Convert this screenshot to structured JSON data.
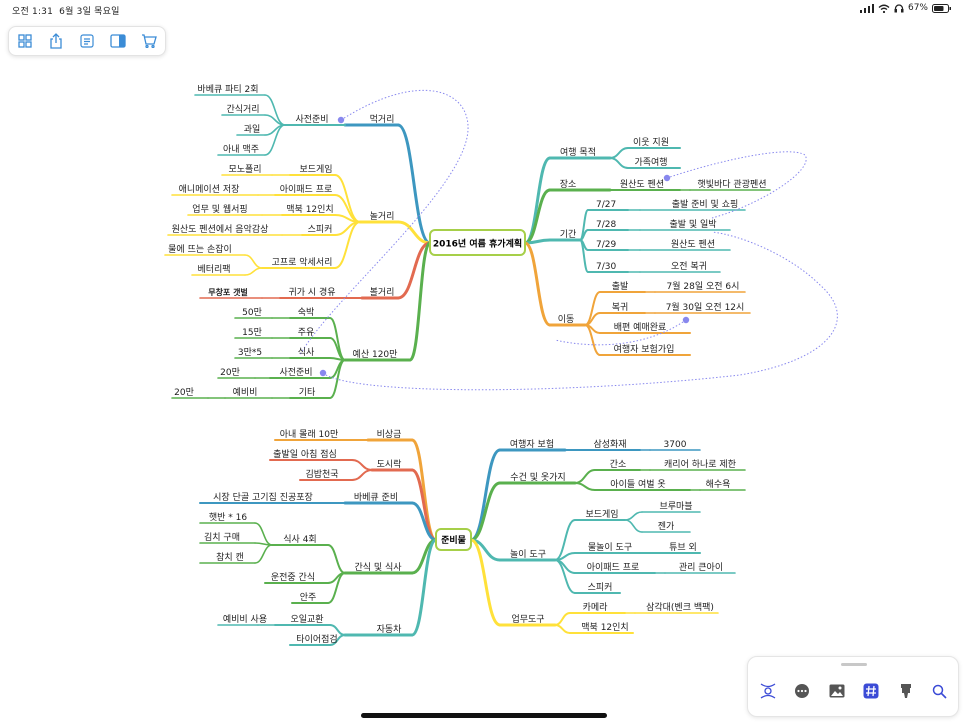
{
  "status_bar": {
    "time": "오전 1:31",
    "date": "6월 3일 목요일",
    "battery": "67%"
  },
  "toolbar": {
    "buttons": [
      "grid-view",
      "share",
      "outline",
      "panel",
      "cart"
    ]
  },
  "colors": {
    "teal": "#4fb8b0",
    "blue": "#3d97c0",
    "yellow": "#ffe13a",
    "green": "#5ab04e",
    "red": "#e26a50",
    "orange": "#f0a43a",
    "relation": "#8888ee",
    "root_border": "#a6cf49"
  },
  "map1": {
    "root": "2016년 여름 휴가계획",
    "food": "먹거리",
    "food_prep": "사전준비",
    "food_bbq": "바베큐 파티 2회",
    "food_snack": "간식거리",
    "food_fruit": "과일",
    "food_beer": "아내 맥주",
    "play": "놀거리",
    "play_board": "보드게임",
    "play_monopoly": "모노폴리",
    "play_ipad": "아이패드 프로",
    "play_anim": "애니메이션 저장",
    "play_mac": "맥북 12인치",
    "play_web": "업무 및 웹서핑",
    "play_speaker": "스피커",
    "play_music": "원산도 펜션에서 음악감상",
    "play_gopro": "고프로 악세서리",
    "play_mount": "물에 뜨는 손잡이",
    "play_battery": "베터리팩",
    "see": "볼거리",
    "see_return": "귀가 시 경유",
    "see_mud": "무창포 갯벌",
    "budget": "예산 120만",
    "budget_stay": "숙박",
    "budget_stay_v": "50만",
    "budget_fuel": "주유",
    "budget_fuel_v": "15만",
    "budget_meal": "식사",
    "budget_meal_v": "3만*5",
    "budget_prep": "사전준비",
    "budget_prep_v": "20만",
    "budget_etc": "기타",
    "budget_spare": "예비비",
    "budget_spare_v": "20만",
    "purpose": "여행 목적",
    "purpose_help": "이웃 지원",
    "purpose_family": "가족여행",
    "place": "장소",
    "place_pension": "원산도 펜션",
    "place_tour": "햇빛바다 관광펜션",
    "period": "기간",
    "d1": "7/27",
    "d1_v": "출발 준비 및 쇼핑",
    "d2": "7/28",
    "d2_v": "출발 및 일박",
    "d3": "7/29",
    "d3_v": "원산도 펜션",
    "d4": "7/30",
    "d4_v": "오전 복귀",
    "move": "이동",
    "move_dep": "출발",
    "move_dep_v": "7월 28일 오전 6시",
    "move_ret": "복귀",
    "move_ret_v": "7월 30일 오전 12시",
    "move_ship": "배편 예매완료",
    "move_ins": "여행자 보험가입"
  },
  "map2": {
    "root": "준비물",
    "emerg": "비상금",
    "emerg_v": "아내 몰래 10만",
    "lunch": "도시락",
    "lunch_b": "출발일 아침 점심",
    "lunch_k": "김밥천국",
    "bbq": "바베큐 준비",
    "bbq_v": "시장 단골 고기집 진공포장",
    "snackmeal": "간식 및 식사",
    "meal4": "식사 4회",
    "rice": "햇반 * 16",
    "kimchi": "김치 구매",
    "tuna": "참치 캔",
    "drive_snack": "운전중 간식",
    "anju": "안주",
    "car": "자동차",
    "oil": "오일교환",
    "oil_v": "예비비 사용",
    "tire": "타이어점검",
    "ins": "여행자 보험",
    "ins_co": "삼성화재",
    "ins_v": "3700",
    "towel": "수건 및 옷가지",
    "towel_g": "간소",
    "towel_g_v": "캐리어 하나로 제한",
    "towel_kid": "아이들 여벌 옷",
    "towel_kid_v": "해수욕",
    "toys": "놀이 도구",
    "toys_board": "보드게임",
    "toys_bru": "브루마블",
    "toys_jenga": "젠가",
    "toys_water": "물놀이 도구",
    "toys_tube": "튜브 외",
    "toys_ipad": "아이패드 프로",
    "toys_ipad_v": "관리 큰아이",
    "toys_speaker": "스피커",
    "work": "업무도구",
    "work_cam": "카메라",
    "work_tripod": "삼각대(벤크 백팩)",
    "work_mac": "맥북 12인치"
  },
  "bottom_toolbar": {
    "buttons": [
      "relationship",
      "more",
      "image",
      "hashtag",
      "marker",
      "search"
    ]
  }
}
